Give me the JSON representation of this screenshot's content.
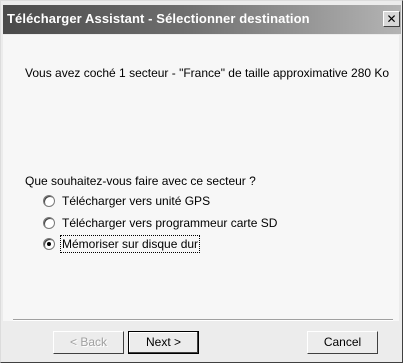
{
  "window": {
    "title": "Télécharger Assistant - Sélectionner destination",
    "close_glyph": "✕"
  },
  "content": {
    "info": "Vous avez coché 1 secteur - \"France\" de taille approximative 280 Ko",
    "question": "Que souhaitez-vous faire avec ce secteur ?",
    "options": [
      {
        "label": "Télécharger vers unité GPS",
        "selected": false
      },
      {
        "label": "Télécharger vers programmeur carte SD",
        "selected": false
      },
      {
        "label": "Mémoriser sur disque dur",
        "selected": true
      }
    ]
  },
  "buttons": {
    "back": "< Back",
    "next": "Next >",
    "cancel": "Cancel"
  }
}
